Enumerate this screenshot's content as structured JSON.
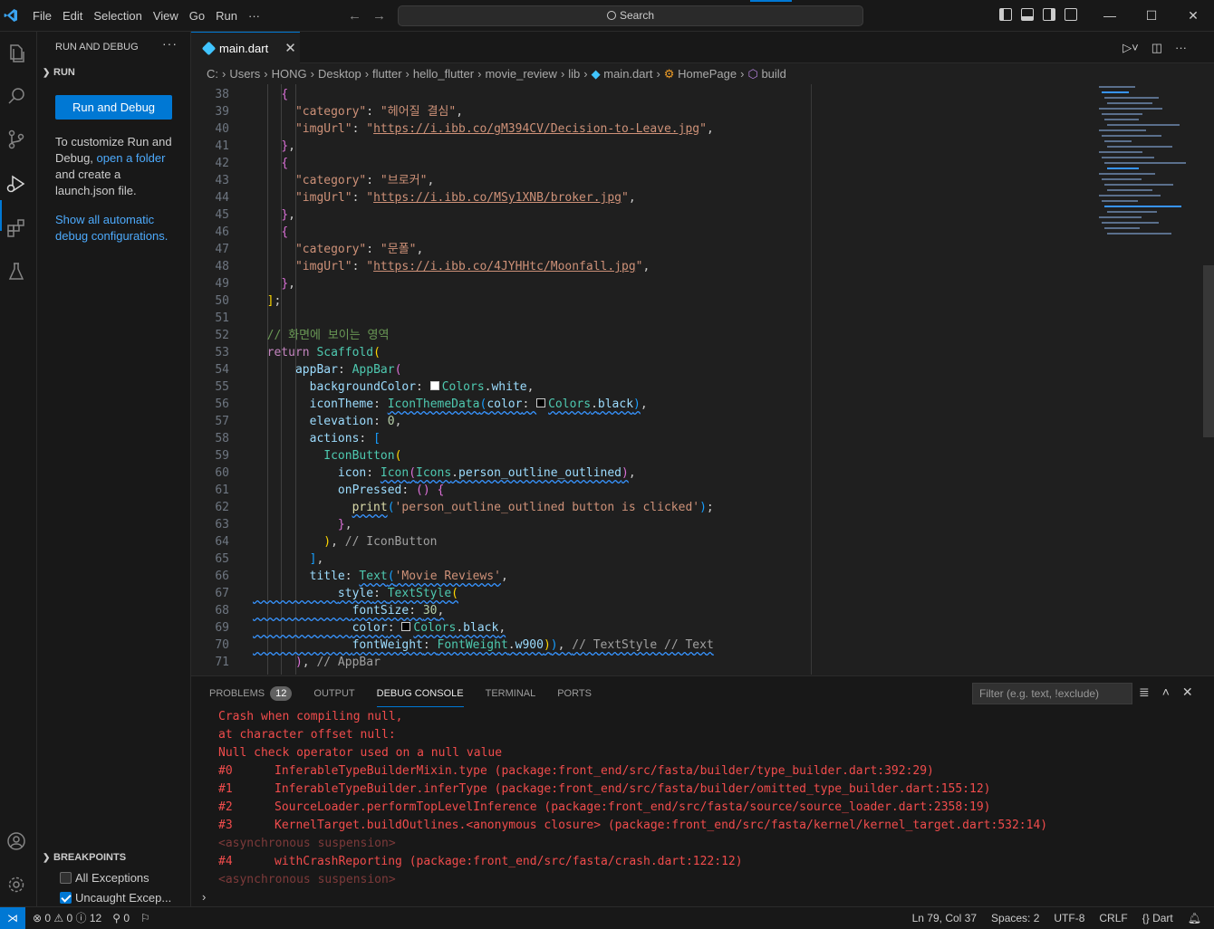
{
  "titlebar": {
    "menu": [
      "File",
      "Edit",
      "Selection",
      "View",
      "Go",
      "Run",
      "···"
    ],
    "search": "Search"
  },
  "sidebar": {
    "header": "RUN AND DEBUG",
    "more": "···",
    "section": "RUN",
    "run_button": "Run and Debug",
    "text_before_link": "To customize Run and Debug, ",
    "open_folder_link": "open a folder",
    "text_after_link": " and create a launch.json file.",
    "show_configs_link": "Show all automatic debug configurations.",
    "breakpoints": {
      "header": "BREAKPOINTS",
      "items": [
        {
          "label": "All Exceptions",
          "checked": false
        },
        {
          "label": "Uncaught Excep...",
          "checked": true
        }
      ]
    }
  },
  "editor": {
    "tab": {
      "label": "main.dart",
      "close": "✕"
    },
    "breadcrumb": [
      "C:",
      "Users",
      "HONG",
      "Desktop",
      "flutter",
      "hello_flutter",
      "movie_review",
      "lib",
      "main.dart",
      "HomePage",
      "build"
    ]
  },
  "code_lines": [
    38,
    39,
    40,
    41,
    42,
    43,
    44,
    45,
    46,
    47,
    48,
    49,
    50,
    51,
    52,
    53,
    54,
    55,
    56,
    57,
    58,
    59,
    60,
    61,
    62,
    63,
    64,
    65,
    66,
    67,
    68,
    69,
    70,
    71
  ],
  "code": {
    "l39_key": "\"category\"",
    "l39_val": "\"헤어질 결심\"",
    "l40_key": "\"imgUrl\"",
    "l40_val": "https://i.ibb.co/gM394CV/Decision-to-Leave.jpg",
    "l43_key": "\"category\"",
    "l43_val": "\"브로커\"",
    "l44_key": "\"imgUrl\"",
    "l44_val": "https://i.ibb.co/MSy1XNB/broker.jpg",
    "l47_key": "\"category\"",
    "l47_val": "\"문폴\"",
    "l48_key": "\"imgUrl\"",
    "l48_val": "https://i.ibb.co/4JYHHtc/Moonfall.jpg",
    "l52_comment": "// 화면에 보이는 영역",
    "l62_print": "'person_outline_outlined button is clicked'",
    "l64_comment": "// IconButton",
    "l66_title": "'Movie Reviews'",
    "l70_comment": "// TextStyle // Text",
    "l71_comment": "// AppBar"
  },
  "panel": {
    "tabs": [
      "PROBLEMS",
      "OUTPUT",
      "DEBUG CONSOLE",
      "TERMINAL",
      "PORTS"
    ],
    "problems_count": "12",
    "filter_placeholder": "Filter (e.g. text, !exclude)",
    "console": [
      {
        "text": "Crash when compiling null,"
      },
      {
        "text": "at character offset null:"
      },
      {
        "text": "Null check operator used on a null value"
      },
      {
        "idx": "#0",
        "text": "InferableTypeBuilderMixin.type (package:front_end/src/fasta/builder/type_builder.dart:392:29)"
      },
      {
        "idx": "#1",
        "text": "InferableTypeBuilder.inferType (package:front_end/src/fasta/builder/omitted_type_builder.dart:155:12)"
      },
      {
        "idx": "#2",
        "text": "SourceLoader.performTopLevelInference (package:front_end/src/fasta/source/source_loader.dart:2358:19)"
      },
      {
        "idx": "#3",
        "text": "KernelTarget.buildOutlines.<anonymous closure> (package:front_end/src/fasta/kernel/kernel_target.dart:532:14)"
      },
      {
        "dim": "<asynchronous suspension>"
      },
      {
        "idx": "#4",
        "text": "withCrashReporting (package:front_end/src/fasta/crash.dart:122:12)"
      },
      {
        "dim": "<asynchronous suspension>"
      }
    ]
  },
  "statusbar": {
    "errors": "0",
    "warnings": "0",
    "infos": "12",
    "ports": "0",
    "position": "Ln 79, Col 37",
    "spaces": "Spaces: 2",
    "encoding": "UTF-8",
    "eol": "CRLF",
    "language": "Dart"
  },
  "colors": {
    "accent": "#0078d4",
    "error": "#f14c4c",
    "background": "#1f1f1f"
  }
}
